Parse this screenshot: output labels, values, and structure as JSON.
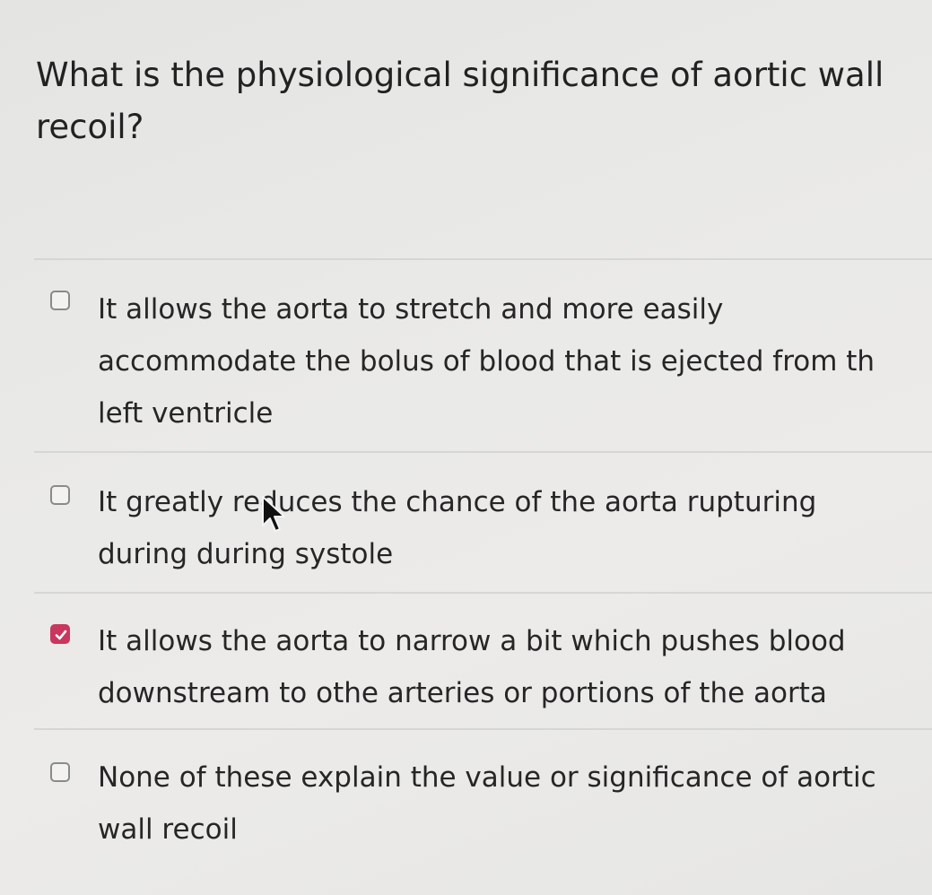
{
  "question": {
    "text": "What is the physiological significance of aortic wall\nrecoil?"
  },
  "options": [
    {
      "text": "It allows the aorta to stretch and more easily\naccommodate the bolus of blood that is ejected from th\nleft ventricle",
      "checked": false
    },
    {
      "text": "It greatly reduces the chance of the aorta rupturing\nduring during systole",
      "checked": false
    },
    {
      "text": "It allows the aorta to narrow a bit which pushes blood\ndownstream to othe arteries or portions of the aorta",
      "checked": true
    },
    {
      "text": "None of these explain the value or significance of aortic\nwall recoil",
      "checked": false
    }
  ],
  "colors": {
    "checked_box": "#c9375e",
    "text": "#262626"
  },
  "icons": {
    "checkmark": "checkmark-icon",
    "cursor": "mouse-pointer-icon"
  }
}
